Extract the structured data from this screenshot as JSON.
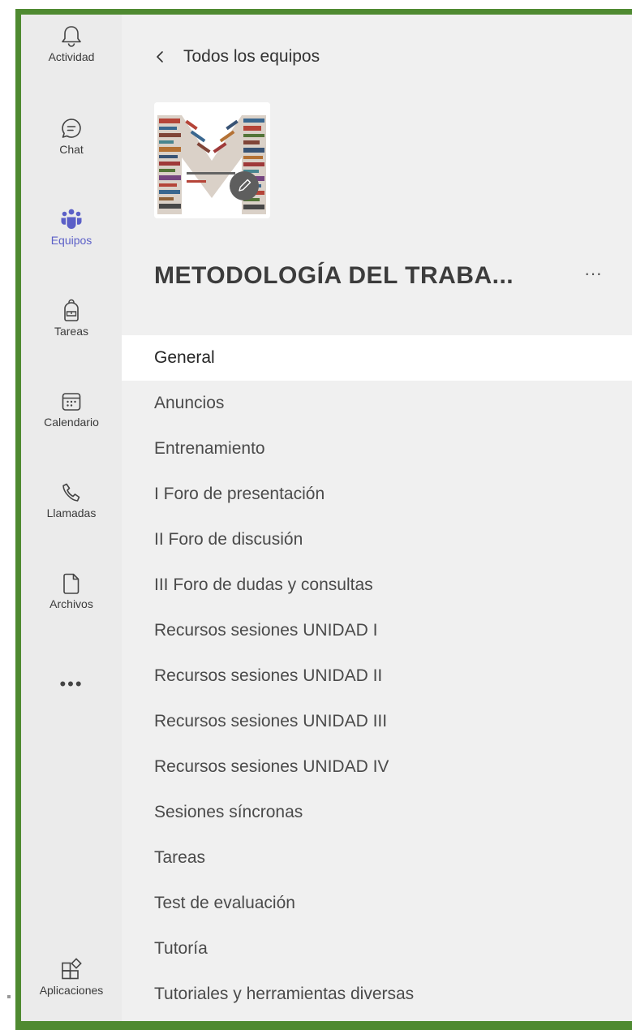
{
  "rail": {
    "items": [
      {
        "label": "Actividad",
        "icon": "bell-icon"
      },
      {
        "label": "Chat",
        "icon": "chat-icon"
      },
      {
        "label": "Equipos",
        "icon": "teams-icon"
      },
      {
        "label": "Tareas",
        "icon": "backpack-icon"
      },
      {
        "label": "Calendario",
        "icon": "calendar-icon"
      },
      {
        "label": "Llamadas",
        "icon": "phone-icon"
      },
      {
        "label": "Archivos",
        "icon": "file-icon"
      }
    ],
    "more": "•••",
    "apps_label": "Aplicaciones",
    "active_index": 2,
    "active_color": "#5b5fc7"
  },
  "panel": {
    "back_label": "Todos los equipos",
    "team_title": "METODOLOGÍA DEL TRABA...",
    "team_more": "···",
    "channels": [
      "General",
      "Anuncios",
      "Entrenamiento",
      "I Foro de presentación",
      "II Foro de discusión",
      "III Foro de dudas y consultas",
      "Recursos sesiones UNIDAD I",
      "Recursos sesiones UNIDAD II",
      "Recursos sesiones UNIDAD III",
      "Recursos sesiones UNIDAD IV",
      "Sesiones síncronas",
      "Tareas",
      "Test de evaluación",
      "Tutoría",
      "Tutoriales y herramientas diversas"
    ],
    "selected_channel_index": 0
  },
  "colors": {
    "frame": "#4f8a31",
    "rail_bg": "#ebebeb",
    "panel_bg": "#f0f0f0",
    "selected_bg": "#ffffff"
  }
}
